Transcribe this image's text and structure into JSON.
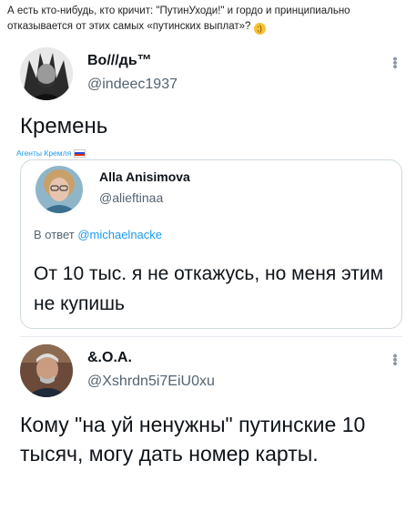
{
  "caption": {
    "text": "А есть кто-нибудь, кто кричит: \"ПутинУходи!\" и гордо и принципиально отказывается от этих самых «путинских выплат»?"
  },
  "tweet1": {
    "name": "Во///дь™",
    "handle": "@indeec1937",
    "text": "Кремень",
    "label": "Агенты Кремля"
  },
  "quote": {
    "name": "Alla Anisimova",
    "handle": "@alieftinaa",
    "reply_prefix": "В ответ",
    "reply_handle": "@michaelnacke",
    "text": "От 10 тыс. я не откажусь, но меня этим не купишь"
  },
  "tweet2": {
    "name": "&.О.А.",
    "handle": "@Xshrdn5i7EiU0xu",
    "text": "Кому \"на уй ненужны\" путинские 10 тысяч, могу дать номер карты."
  },
  "colors": {
    "accent": "#1d9bf0",
    "secondary_text": "#536471",
    "border": "#cfd9de"
  }
}
